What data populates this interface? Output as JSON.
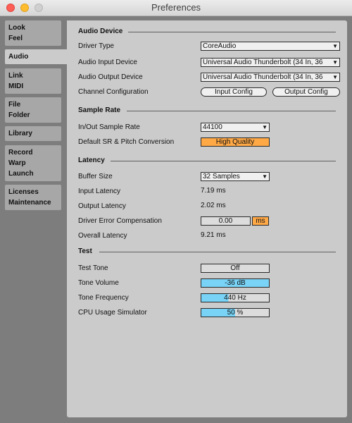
{
  "window": {
    "title": "Preferences"
  },
  "sidebar": {
    "tabs": [
      {
        "lines": [
          "Look",
          "Feel"
        ]
      },
      {
        "lines": [
          "Audio"
        ],
        "active": true
      },
      {
        "lines": [
          "Link",
          "MIDI"
        ]
      },
      {
        "lines": [
          "File",
          "Folder"
        ]
      },
      {
        "lines": [
          "Library"
        ]
      },
      {
        "lines": [
          "Record",
          "Warp",
          "Launch"
        ]
      },
      {
        "lines": [
          "Licenses",
          "Maintenance"
        ]
      }
    ]
  },
  "audio_device": {
    "title": "Audio Device",
    "driver_type_label": "Driver Type",
    "driver_type_value": "CoreAudio",
    "input_device_label": "Audio Input Device",
    "input_device_value": "Universal Audio Thunderbolt (34 In, 36",
    "output_device_label": "Audio Output Device",
    "output_device_value": "Universal Audio Thunderbolt (34 In, 36",
    "channel_config_label": "Channel Configuration",
    "input_config_button": "Input Config",
    "output_config_button": "Output Config"
  },
  "sample_rate": {
    "title": "Sample Rate",
    "in_out_label": "In/Out Sample Rate",
    "in_out_value": "44100",
    "default_sr_label": "Default SR & Pitch Conversion",
    "default_sr_value": "High Quality"
  },
  "latency": {
    "title": "Latency",
    "buffer_size_label": "Buffer Size",
    "buffer_size_value": "32 Samples",
    "input_latency_label": "Input Latency",
    "input_latency_value": "7.19 ms",
    "output_latency_label": "Output Latency",
    "output_latency_value": "2.02 ms",
    "driver_error_label": "Driver Error Compensation",
    "driver_error_value": "0.00",
    "driver_error_unit": "ms",
    "overall_latency_label": "Overall Latency",
    "overall_latency_value": "9.21 ms"
  },
  "test": {
    "title": "Test",
    "test_tone_label": "Test Tone",
    "test_tone_value": "Off",
    "tone_volume_label": "Tone Volume",
    "tone_volume_value": "-36 dB",
    "tone_frequency_label": "Tone Frequency",
    "tone_frequency_value": "440 Hz",
    "cpu_usage_label": "CPU Usage Simulator",
    "cpu_usage_value": "50 %"
  },
  "colors": {
    "accent_orange": "#ffa846",
    "accent_blue": "#78d3f6",
    "panel": "#cbcbcb",
    "sidebar": "#7d7d7d"
  },
  "icons": {
    "dropdown": "triangle-down-icon"
  }
}
